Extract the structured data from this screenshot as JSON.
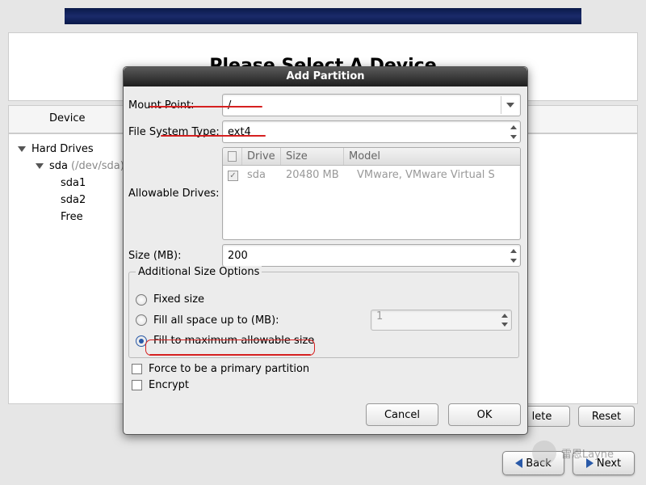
{
  "banner": {},
  "page": {
    "title": "Please Select A Device",
    "device_header": "Device"
  },
  "tree": {
    "root": "Hard Drives",
    "disk": "sda",
    "disk_path": "(/dev/sda)",
    "parts": [
      "sda1",
      "sda2",
      "Free"
    ]
  },
  "buttons": {
    "delete": "lete",
    "reset": "Reset",
    "back": "Back",
    "next": "Next"
  },
  "dialog": {
    "title": "Add Partition",
    "mount_label": "Mount Point:",
    "mount_value": "/",
    "fs_label": "File System Type:",
    "fs_value": "ext4",
    "drives_label": "Allowable Drives:",
    "drives_head": {
      "drive": "Drive",
      "size": "Size",
      "model": "Model"
    },
    "drives_row": {
      "name": "sda",
      "size": "20480 MB",
      "model": "VMware, VMware Virtual S"
    },
    "size_label": "Size (MB):",
    "size_value": "200",
    "addl_label": "Additional Size Options",
    "opt_fixed": "Fixed size",
    "opt_fill_upto": "Fill all space up to (MB):",
    "opt_fill_upto_value": "1",
    "opt_fill_max": "Fill to maximum allowable size",
    "force_primary": "Force to be a primary partition",
    "encrypt": "Encrypt",
    "cancel": "Cancel",
    "ok": "OK"
  },
  "watermark": "雷恩Layne"
}
